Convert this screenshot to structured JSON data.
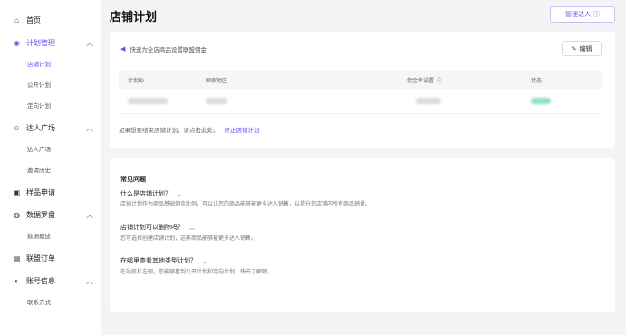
{
  "sidebar": {
    "items": [
      {
        "label": "首页",
        "icon": "home-icon",
        "glyph": "⌂",
        "children": []
      },
      {
        "label": "计划管理",
        "icon": "plan-icon",
        "glyph": "◉",
        "expanded": true,
        "children": [
          "店铺计划",
          "公开计划",
          "定向计划"
        ]
      },
      {
        "label": "达人广场",
        "icon": "user-icon",
        "glyph": "☺",
        "expanded": true,
        "children": [
          "达人广场",
          "邀请历史"
        ]
      },
      {
        "label": "样品申请",
        "icon": "sample-icon",
        "glyph": "▣",
        "children": []
      },
      {
        "label": "数据罗盘",
        "icon": "compass-icon",
        "glyph": "◍",
        "expanded": true,
        "children": [
          "数据概述"
        ]
      },
      {
        "label": "联盟订单",
        "icon": "order-icon",
        "glyph": "▤",
        "children": []
      },
      {
        "label": "账号信息",
        "icon": "account-icon",
        "glyph": "◐",
        "expanded": true,
        "children": [
          "联系方式"
        ]
      }
    ],
    "active_child": "店铺计划"
  },
  "header": {
    "title": "店铺计划",
    "manage_button": "管理达人"
  },
  "plan_card": {
    "tip": "快速为全店商品设置联盟佣金",
    "edit_button": "编辑",
    "columns": [
      "计划ID",
      "国家地区",
      "佣金率设置",
      "状态"
    ],
    "stop_text": "如果想要结束店铺计划，请点击此处。",
    "stop_link": "终止店铺计划"
  },
  "faq": {
    "title": "常见问题",
    "items": [
      {
        "q": "什么是店铺计划？",
        "a": "店铺计划作为商品基础佣金比例，可以让您的商品能够被更多达人销售，以提升您店铺内所有商品销量。"
      },
      {
        "q": "店铺计划可以删除吗？",
        "a": "您可选择创建店铺计划，这样商品能够被更多达人销售。"
      },
      {
        "q": "在哪里查看其他类型计划？",
        "a": "在导航栏左侧，您能够看到公开计划和定向计划，快去了解吧。"
      }
    ]
  },
  "colors": {
    "accent": "#6a4cf5",
    "status_green": "#8fe0bd"
  }
}
